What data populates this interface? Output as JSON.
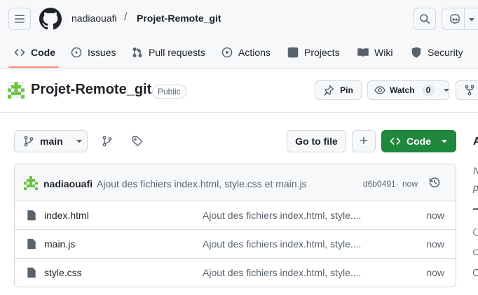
{
  "header": {
    "owner": "nadiaouafi",
    "separator": "/",
    "repo": "Projet-Remote_git"
  },
  "tabs": [
    {
      "label": "Code",
      "icon": "code-icon",
      "active": true
    },
    {
      "label": "Issues",
      "icon": "issue-opened-icon"
    },
    {
      "label": "Pull requests",
      "icon": "git-pull-request-icon"
    },
    {
      "label": "Actions",
      "icon": "play-icon"
    },
    {
      "label": "Projects",
      "icon": "table-icon"
    },
    {
      "label": "Wiki",
      "icon": "book-icon"
    },
    {
      "label": "Security",
      "icon": "shield-icon"
    }
  ],
  "repo": {
    "name": "Projet-Remote_git",
    "visibility": "Public",
    "pin_label": "Pin",
    "watch_label": "Watch",
    "watch_count": "0"
  },
  "toolbar": {
    "branch": "main",
    "go_to_file": "Go to file",
    "add": "+",
    "code_label": "Code"
  },
  "commit": {
    "author": "nadiaouafi",
    "message": "Ajout des fichiers index.html, style.css et main.js",
    "hash": "d6b0491",
    "dot": "·",
    "age": "now"
  },
  "files": [
    {
      "name": "index.html",
      "message": "Ajout des fichiers index.html, style....",
      "age": "now"
    },
    {
      "name": "main.js",
      "message": "Ajout des fichiers index.html, style....",
      "age": "now"
    },
    {
      "name": "style.css",
      "message": "Ajout des fichiers index.html, style....",
      "age": "now"
    }
  ],
  "colors": {
    "accent_green": "#1f883d",
    "active_tab_underline": "#fd8c73",
    "border": "#d1d9e0"
  }
}
